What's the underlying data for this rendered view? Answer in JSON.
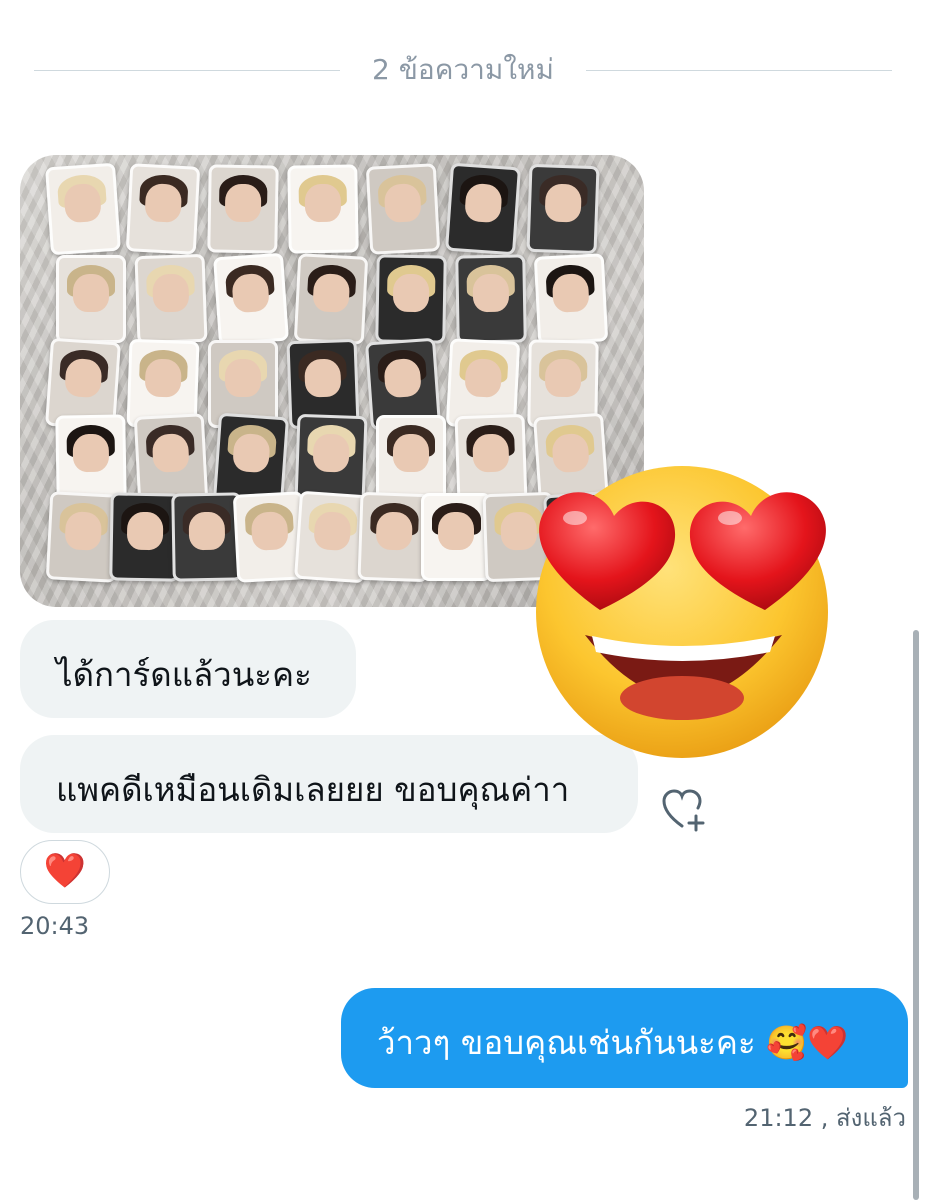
{
  "divider": {
    "label": "2 ข้อความใหม่"
  },
  "photo": {
    "alt": "photo cards collection"
  },
  "messages_in": [
    {
      "text": "ได้การ์ดแล้วนะคะ"
    },
    {
      "text": "แพคดีเหมือนเดิมเลยยย ขอบคุณค่าา"
    }
  ],
  "reaction": {
    "emoji": "❤️"
  },
  "timestamp_in": "20:43",
  "message_out": {
    "text": "ว้าวๆ ขอบคุณเช่นกันนะคะ 🥰❤️"
  },
  "timestamp_out": "21:12 , ส่งแล้ว",
  "overlay_emoji": "heart-eyes-face",
  "colors": {
    "accent": "#1d9bf0",
    "bubble_in": "#eff3f4",
    "muted": "#536471",
    "heart": "#e0245e"
  },
  "icons": {
    "add_reaction": "heart-plus-icon"
  }
}
